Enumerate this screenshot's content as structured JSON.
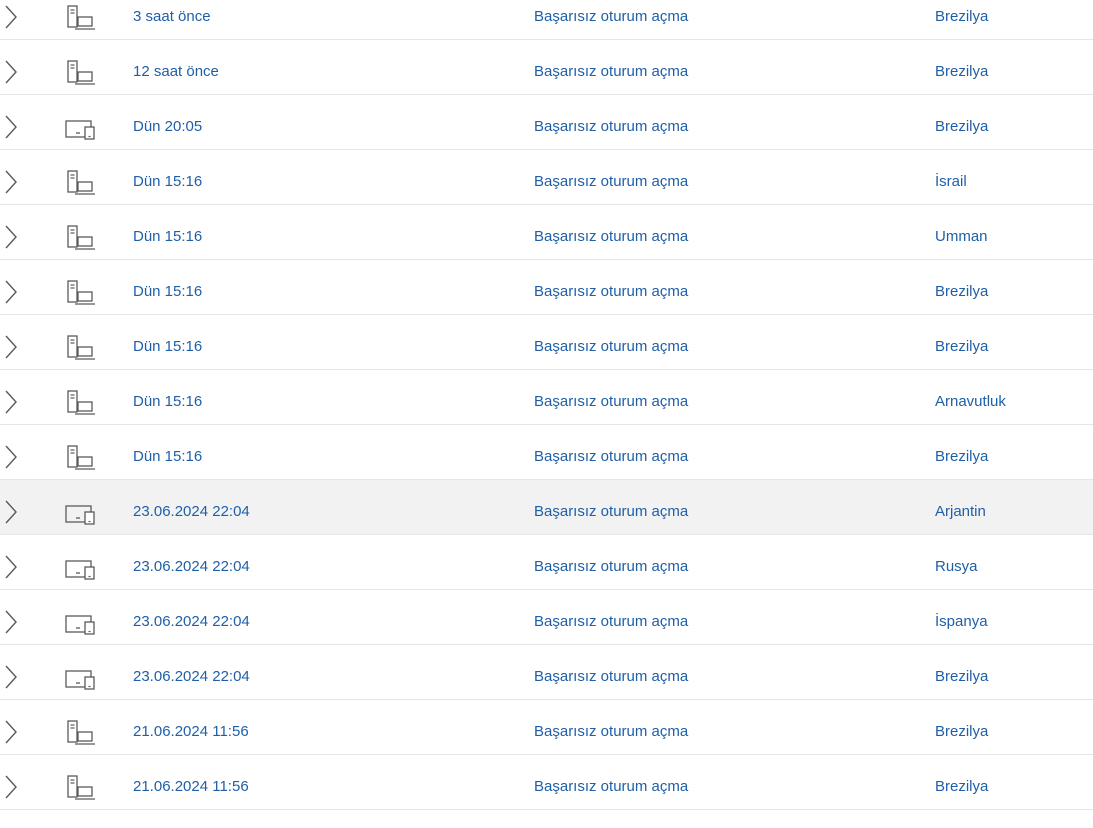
{
  "activity": {
    "rows": [
      {
        "time": "3 saat önce",
        "event": "Başarısız oturum açma",
        "location": "Brezilya",
        "device": "desktop-icon",
        "highlighted": false
      },
      {
        "time": "12 saat önce",
        "event": "Başarısız oturum açma",
        "location": "Brezilya",
        "device": "desktop-icon",
        "highlighted": false
      },
      {
        "time": "Dün 20:05",
        "event": "Başarısız oturum açma",
        "location": "Brezilya",
        "device": "devices-icon",
        "highlighted": false
      },
      {
        "time": "Dün 15:16",
        "event": "Başarısız oturum açma",
        "location": "İsrail",
        "device": "desktop-icon",
        "highlighted": false
      },
      {
        "time": "Dün 15:16",
        "event": "Başarısız oturum açma",
        "location": "Umman",
        "device": "desktop-icon",
        "highlighted": false
      },
      {
        "time": "Dün 15:16",
        "event": "Başarısız oturum açma",
        "location": "Brezilya",
        "device": "desktop-icon",
        "highlighted": false
      },
      {
        "time": "Dün 15:16",
        "event": "Başarısız oturum açma",
        "location": "Brezilya",
        "device": "desktop-icon",
        "highlighted": false
      },
      {
        "time": "Dün 15:16",
        "event": "Başarısız oturum açma",
        "location": "Arnavutluk",
        "device": "desktop-icon",
        "highlighted": false
      },
      {
        "time": "Dün 15:16",
        "event": "Başarısız oturum açma",
        "location": "Brezilya",
        "device": "desktop-icon",
        "highlighted": false
      },
      {
        "time": "23.06.2024 22:04",
        "event": "Başarısız oturum açma",
        "location": "Arjantin",
        "device": "devices-icon",
        "highlighted": true
      },
      {
        "time": "23.06.2024 22:04",
        "event": "Başarısız oturum açma",
        "location": "Rusya",
        "device": "devices-icon",
        "highlighted": false
      },
      {
        "time": "23.06.2024 22:04",
        "event": "Başarısız oturum açma",
        "location": "İspanya",
        "device": "devices-icon",
        "highlighted": false
      },
      {
        "time": "23.06.2024 22:04",
        "event": "Başarısız oturum açma",
        "location": "Brezilya",
        "device": "devices-icon",
        "highlighted": false
      },
      {
        "time": "21.06.2024 11:56",
        "event": "Başarısız oturum açma",
        "location": "Brezilya",
        "device": "desktop-icon",
        "highlighted": false
      },
      {
        "time": "21.06.2024 11:56",
        "event": "Başarısız oturum açma",
        "location": "Brezilya",
        "device": "desktop-icon",
        "highlighted": false
      }
    ]
  },
  "colors": {
    "link_text": "#1f5fa8",
    "icon_stroke": "#5a5a5a",
    "row_divider": "#e6e6e6",
    "row_highlight": "#f2f2f2"
  }
}
